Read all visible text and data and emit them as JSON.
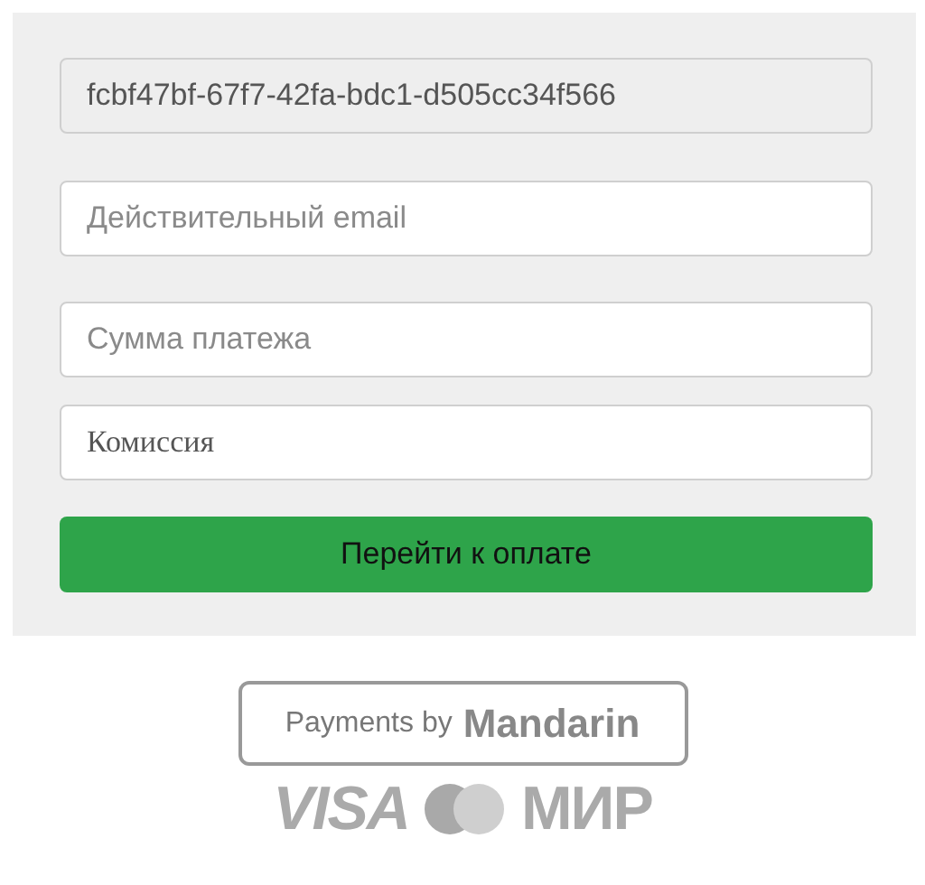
{
  "form": {
    "fields": [
      {
        "kind": "readonly",
        "value": "fcbf47bf-67f7-42fa-bdc1-d505cc34f566",
        "disabled": true
      },
      {
        "kind": "input",
        "placeholder": "Действительный email",
        "disabled": false
      },
      {
        "kind": "input",
        "placeholder": "Сумма платежа",
        "disabled": false
      },
      {
        "kind": "serif",
        "placeholder": "Комиссия",
        "disabled": false
      }
    ],
    "submit": "Перейти к оплате"
  },
  "footer": {
    "badge": {
      "prefix": "Payments by",
      "brand": "Mandarin"
    },
    "cards": {
      "visa": "VISA",
      "mir": "МИР"
    }
  }
}
